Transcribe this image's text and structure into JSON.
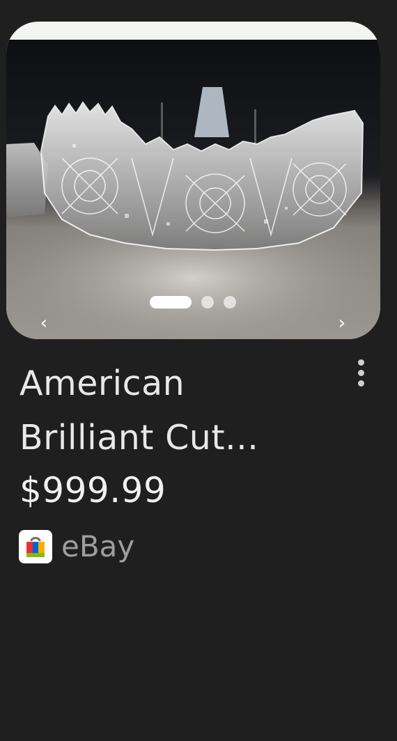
{
  "product": {
    "title": "American Brilliant Cut...",
    "price": "$999.99",
    "seller_name": "eBay",
    "image_description_icon": "cut-glass-bowl-photo"
  },
  "carousel": {
    "prev_icon": "chevron-left-icon",
    "next_icon": "chevron-right-icon",
    "prev_glyph": "‹",
    "next_glyph": "›",
    "total_images": 3,
    "active_index": 0
  },
  "menu": {
    "icon": "more-vertical-icon"
  },
  "colors": {
    "background": "#1f1f1f",
    "card_frame": "#f3f3f1",
    "title_text": "#e8e8e8",
    "seller_text": "#9e9e9e"
  }
}
